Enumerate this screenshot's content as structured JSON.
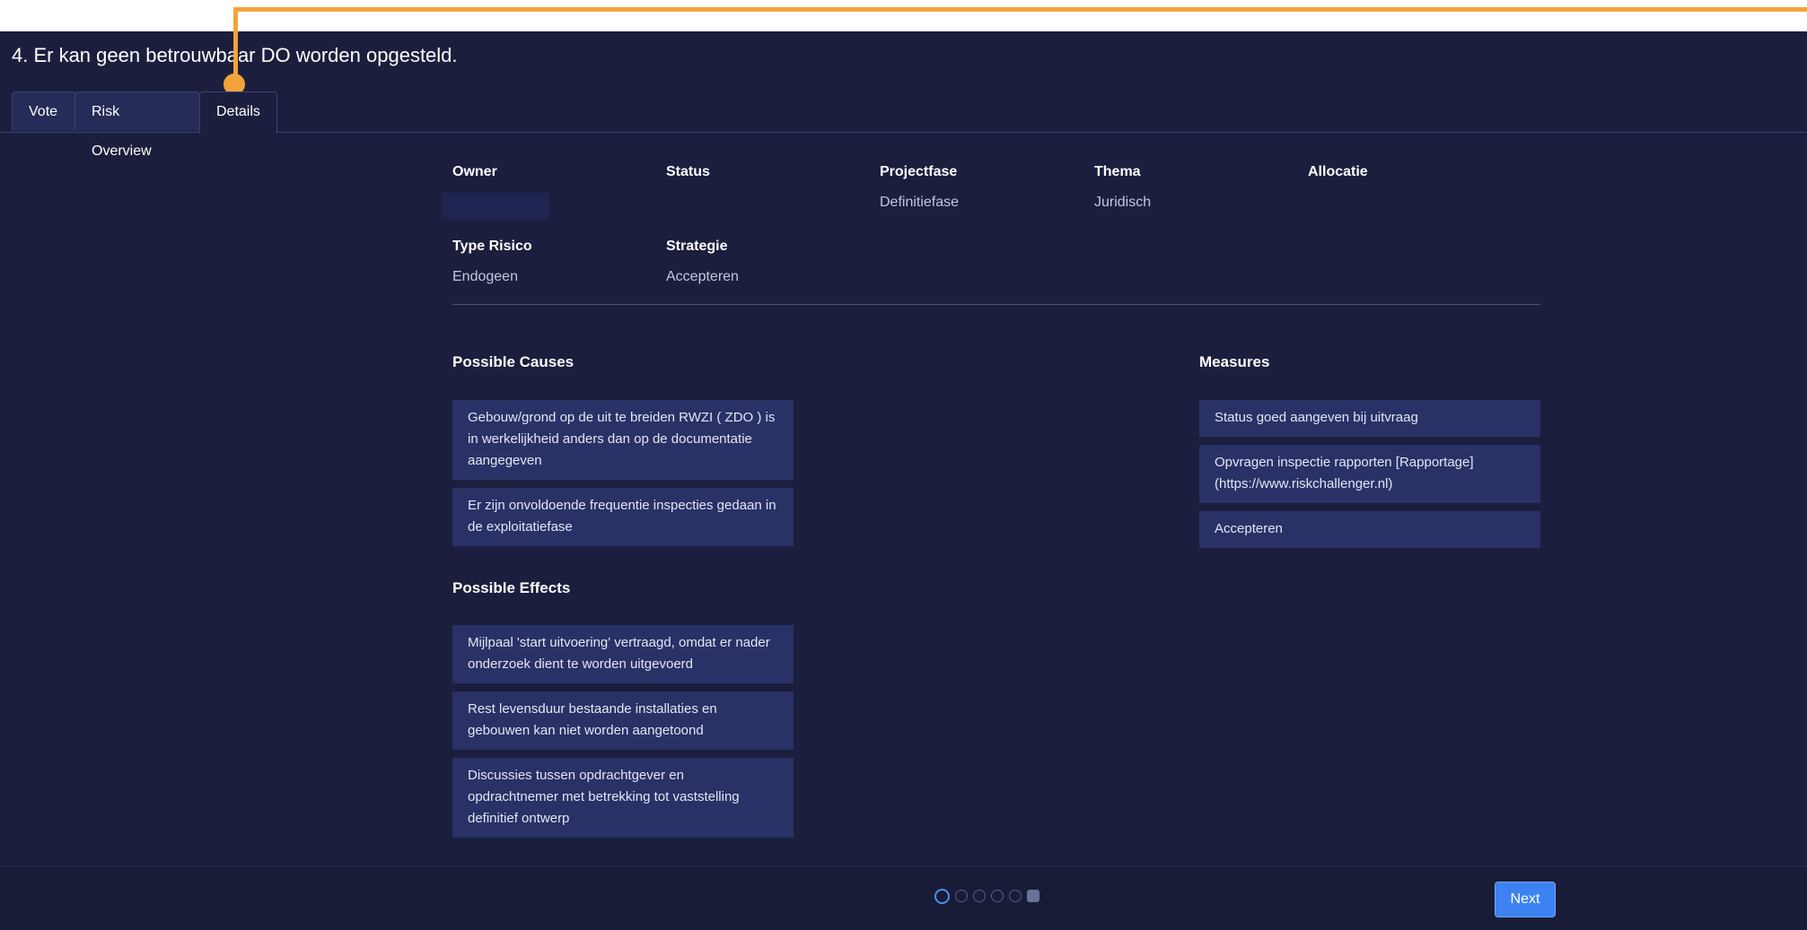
{
  "header": {
    "title": "4. Er kan geen betrouwbaar DO worden opgesteld."
  },
  "tabs": [
    {
      "label": "Vote",
      "active": false
    },
    {
      "label": "Risk Overview",
      "active": false
    },
    {
      "label": "Details",
      "active": true
    }
  ],
  "attributes": {
    "owner": {
      "label": "Owner",
      "value": ""
    },
    "status": {
      "label": "Status",
      "value": ""
    },
    "projectfase": {
      "label": "Projectfase",
      "value": "Definitiefase"
    },
    "thema": {
      "label": "Thema",
      "value": "Juridisch"
    },
    "allocatie": {
      "label": "Allocatie",
      "value": ""
    },
    "type_risico": {
      "label": "Type Risico",
      "value": "Endogeen"
    },
    "strategie": {
      "label": "Strategie",
      "value": "Accepteren"
    }
  },
  "causes": {
    "title": "Possible Causes",
    "items": [
      "Gebouw/grond op de uit te breiden RWZI ( ZDO ) is in werkelijkheid anders dan op de documentatie aangegeven",
      "Er zijn onvoldoende frequentie inspecties gedaan in de exploitatiefase"
    ]
  },
  "effects": {
    "title": "Possible Effects",
    "items": [
      "Mijlpaal 'start uitvoering' vertraagd, omdat er nader onderzoek dient te worden uitgevoerd",
      "Rest levensduur bestaande installaties en gebouwen kan niet worden aangetoond",
      "Discussies tussen opdrachtgever en opdrachtnemer met betrekking tot vaststelling definitief ontwerp"
    ]
  },
  "measures": {
    "title": "Measures",
    "items": [
      "Status goed aangeven bij uitvraag",
      "Opvragen inspectie rapporten [Rapportage] (https://www.riskchallenger.nl)",
      "Accepteren"
    ]
  },
  "footer": {
    "next_label": "Next",
    "progress_total": 6,
    "progress_current": 6
  },
  "colors": {
    "background": "#1b1f3d",
    "card": "#2a3166",
    "accent": "#3d82f2",
    "callout": "#f2a33a"
  }
}
